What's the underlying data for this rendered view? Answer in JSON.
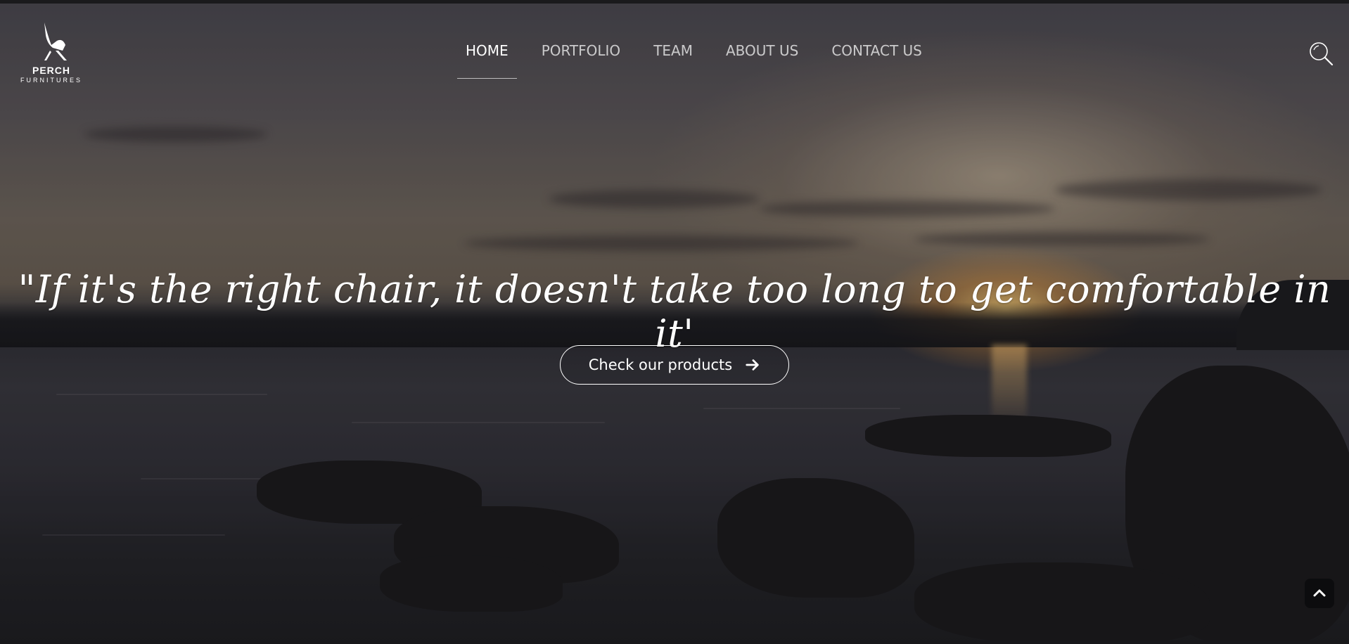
{
  "brand": {
    "name": "PERCH",
    "subtitle": "FURNITURES",
    "logo_icon": "chair-icon"
  },
  "nav": {
    "items": [
      {
        "label": "HOME",
        "active": true
      },
      {
        "label": "PORTFOLIO",
        "active": false
      },
      {
        "label": "TEAM",
        "active": false
      },
      {
        "label": "ABOUT US",
        "active": false
      },
      {
        "label": "CONTACT US",
        "active": false
      }
    ]
  },
  "header": {
    "search_icon": "search-icon"
  },
  "hero": {
    "quote": "\"If it's the right chair, it doesn't take too long to get comfortable in it'",
    "cta_label": "Check our products",
    "cta_icon": "arrow-right-icon"
  },
  "scroll_top": {
    "icon": "chevron-up-icon"
  },
  "colors": {
    "text": "#ffffff",
    "nav_inactive": "#b8b8bc",
    "scroll_top_bg": "#0c0c0e"
  }
}
